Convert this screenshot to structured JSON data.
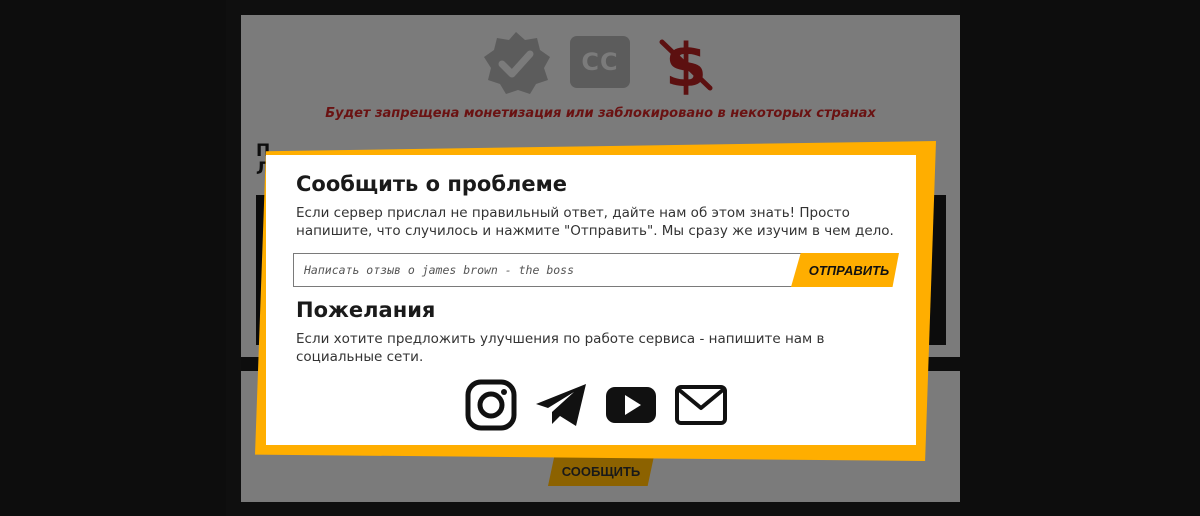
{
  "background_page": {
    "warning_text": "Будет запрещена монетизация или заблокировано в некоторых странах",
    "heading_fragment": "П Л",
    "report_button_label": "СООБЩИТЬ",
    "icons": [
      "verified-badge-icon",
      "closed-captions-icon",
      "no-monetization-icon"
    ],
    "cc_label": "CC"
  },
  "modal": {
    "report_title": "Сообщить о проблеме",
    "report_text": "Если сервер прислал не правильный ответ, дайте нам об этом знать! Просто напишите, что случилось и нажмите \"Отправить\". Мы сразу же изучим в чем дело.",
    "feedback_placeholder": "Написать отзыв о james brown - the boss",
    "send_label": "ОТПРАВИТЬ",
    "wishes_title": "Пожелания",
    "wishes_text": "Если хотите предложить улучшения по работе сервиса - напишите нам в социальные сети.",
    "socials": [
      "instagram-icon",
      "telegram-icon",
      "youtube-icon",
      "email-icon"
    ]
  },
  "colors": {
    "accent": "#ffae00",
    "overlay_gray": "#7b7b7b",
    "warning_red": "#6a1212"
  }
}
